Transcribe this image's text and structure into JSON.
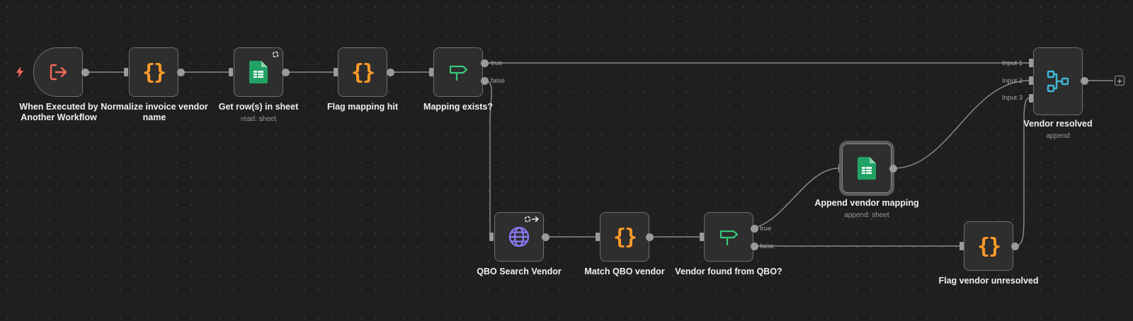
{
  "nodes": {
    "trigger": {
      "label": "When Executed by Another Workflow",
      "icon": "sign-in-arrow-icon"
    },
    "normalize": {
      "label": "Normalize invoice vendor name",
      "icon": "code-braces-icon"
    },
    "get_rows": {
      "label": "Get row(s) in sheet",
      "sub": "read: sheet",
      "icon": "google-sheets-icon"
    },
    "flag_hit": {
      "label": "Flag mapping hit",
      "icon": "code-braces-icon"
    },
    "mapping_exists": {
      "label": "Mapping exists?",
      "icon": "signpost-icon",
      "out_true": "true",
      "out_false": "false"
    },
    "qbo_search": {
      "label": "QBO Search Vendor",
      "icon": "globe-icon"
    },
    "match_qbo": {
      "label": "Match QBO vendor",
      "icon": "code-braces-icon"
    },
    "vendor_found": {
      "label": "Vendor found from QBO?",
      "icon": "signpost-icon",
      "out_true": "true",
      "out_false": "false"
    },
    "append_mapping": {
      "label": "Append vendor mapping",
      "sub": "append: sheet",
      "icon": "google-sheets-icon"
    },
    "flag_unresolved": {
      "label": "Flag vendor unresolved",
      "icon": "code-braces-icon"
    },
    "vendor_resolved": {
      "label": "Vendor resolved",
      "sub": "append",
      "icon": "merge-icon",
      "in1": "Input 1",
      "in2": "Input 2",
      "in3": "Input 3"
    }
  },
  "code_glyph": "{}",
  "add_glyph": "+",
  "colors": {
    "code": "#ff9b28",
    "sheets": "#21a366",
    "if": "#36c77a",
    "http": "#8b7cf6",
    "merge": "#3fb7d9",
    "trigger": "#f2685a"
  }
}
